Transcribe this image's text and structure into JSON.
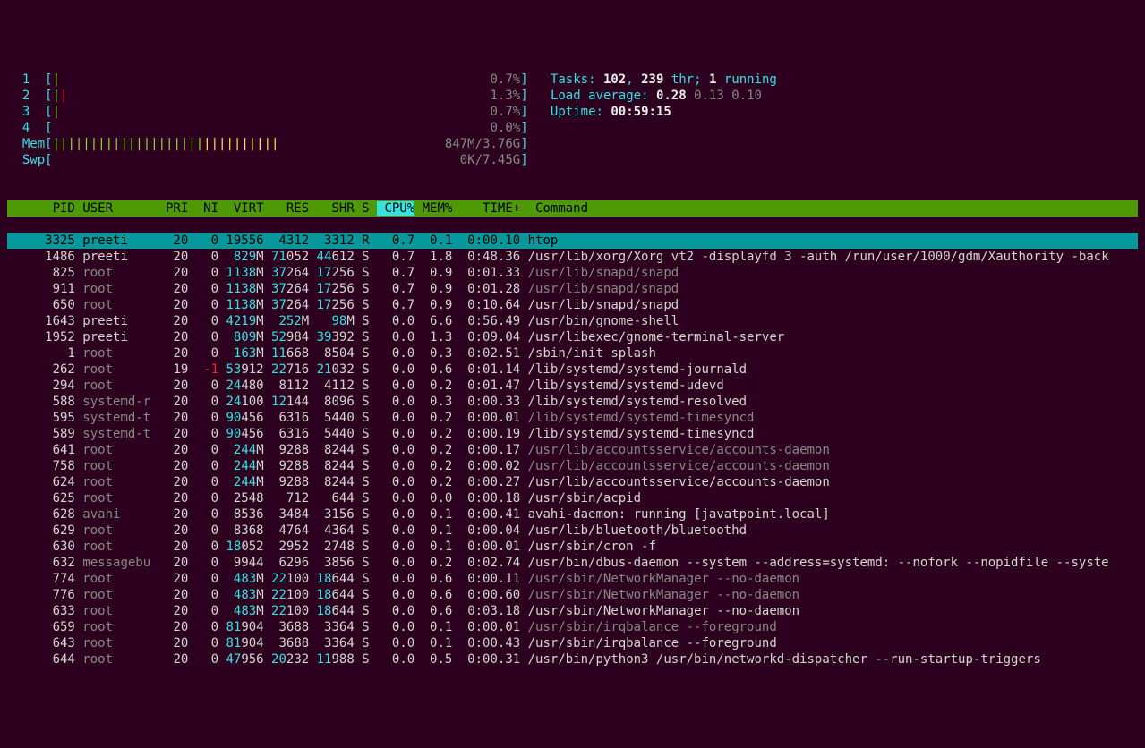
{
  "cpus": [
    {
      "id": "1",
      "pct": "0.7%"
    },
    {
      "id": "2",
      "pct": "1.3%"
    },
    {
      "id": "3",
      "pct": "0.7%"
    },
    {
      "id": "4",
      "pct": "0.0%"
    }
  ],
  "mem": {
    "label": "Mem",
    "used": "847M",
    "total": "3.76G"
  },
  "swp": {
    "label": "Swp",
    "used": "0K",
    "total": "7.45G"
  },
  "tasks": {
    "label": "Tasks:",
    "total": "102",
    "threads": "239",
    "thr_label": "thr;",
    "running": "1",
    "running_label": "running"
  },
  "load": {
    "label": "Load average:",
    "a": "0.28",
    "b": "0.13",
    "c": "0.10"
  },
  "uptime": {
    "label": "Uptime:",
    "value": "00:59:15"
  },
  "columns": {
    "pid": "PID",
    "user": "USER",
    "pri": "PRI",
    "ni": "NI",
    "virt": "VIRT",
    "res": "RES",
    "shr": "SHR",
    "s": "S",
    "cpu": "CPU%",
    "mem": "MEM%",
    "time": "TIME+",
    "cmd": "Command"
  },
  "rows": [
    {
      "pid": "3325",
      "user": "preeti",
      "udim": false,
      "pri": "20",
      "ni": "0",
      "ni_red": false,
      "virt_hi": "",
      "virt_lo": "19556",
      "res_hi": "",
      "res_lo": "4312",
      "shr_hi": "",
      "shr_lo": "3312",
      "s": "R",
      "cpu": "0.7",
      "mem": "0.1",
      "time": "0:00.10",
      "cmd": "htop",
      "cmd_dim": false,
      "sel": true
    },
    {
      "pid": "1486",
      "user": "preeti",
      "udim": false,
      "pri": "20",
      "ni": "0",
      "ni_red": false,
      "virt_hi": "829",
      "virt_lo": "M",
      "res_hi": "71",
      "res_lo": "052",
      "shr_hi": "44",
      "shr_lo": "612",
      "s": "S",
      "cpu": "0.7",
      "mem": "1.8",
      "time": "0:48.36",
      "cmd": "/usr/lib/xorg/Xorg vt2 -displayfd 3 -auth /run/user/1000/gdm/Xauthority -back",
      "cmd_dim": false,
      "sel": false
    },
    {
      "pid": "825",
      "user": "root",
      "udim": true,
      "pri": "20",
      "ni": "0",
      "ni_red": false,
      "virt_hi": "1138",
      "virt_lo": "M",
      "res_hi": "37",
      "res_lo": "264",
      "shr_hi": "17",
      "shr_lo": "256",
      "s": "S",
      "cpu": "0.7",
      "mem": "0.9",
      "time": "0:01.33",
      "cmd": "/usr/lib/snapd/snapd",
      "cmd_dim": true,
      "sel": false
    },
    {
      "pid": "911",
      "user": "root",
      "udim": true,
      "pri": "20",
      "ni": "0",
      "ni_red": false,
      "virt_hi": "1138",
      "virt_lo": "M",
      "res_hi": "37",
      "res_lo": "264",
      "shr_hi": "17",
      "shr_lo": "256",
      "s": "S",
      "cpu": "0.7",
      "mem": "0.9",
      "time": "0:01.28",
      "cmd": "/usr/lib/snapd/snapd",
      "cmd_dim": true,
      "sel": false
    },
    {
      "pid": "650",
      "user": "root",
      "udim": true,
      "pri": "20",
      "ni": "0",
      "ni_red": false,
      "virt_hi": "1138",
      "virt_lo": "M",
      "res_hi": "37",
      "res_lo": "264",
      "shr_hi": "17",
      "shr_lo": "256",
      "s": "S",
      "cpu": "0.7",
      "mem": "0.9",
      "time": "0:10.64",
      "cmd": "/usr/lib/snapd/snapd",
      "cmd_dim": false,
      "sel": false
    },
    {
      "pid": "1643",
      "user": "preeti",
      "udim": false,
      "pri": "20",
      "ni": "0",
      "ni_red": false,
      "virt_hi": "4219",
      "virt_lo": "M",
      "res_hi": "252",
      "res_lo": "M",
      "shr_hi": "98",
      "shr_lo": "M",
      "s": "S",
      "cpu": "0.0",
      "mem": "6.6",
      "time": "0:56.49",
      "cmd": "/usr/bin/gnome-shell",
      "cmd_dim": false,
      "sel": false
    },
    {
      "pid": "1952",
      "user": "preeti",
      "udim": false,
      "pri": "20",
      "ni": "0",
      "ni_red": false,
      "virt_hi": "809",
      "virt_lo": "M",
      "res_hi": "52",
      "res_lo": "984",
      "shr_hi": "39",
      "shr_lo": "392",
      "s": "S",
      "cpu": "0.0",
      "mem": "1.3",
      "time": "0:09.04",
      "cmd": "/usr/libexec/gnome-terminal-server",
      "cmd_dim": false,
      "sel": false
    },
    {
      "pid": "1",
      "user": "root",
      "udim": true,
      "pri": "20",
      "ni": "0",
      "ni_red": false,
      "virt_hi": "163",
      "virt_lo": "M",
      "res_hi": "11",
      "res_lo": "668",
      "shr_hi": "",
      "shr_lo": "8504",
      "s": "S",
      "cpu": "0.0",
      "mem": "0.3",
      "time": "0:02.51",
      "cmd": "/sbin/init splash",
      "cmd_dim": false,
      "sel": false
    },
    {
      "pid": "262",
      "user": "root",
      "udim": true,
      "pri": "19",
      "ni": "-1",
      "ni_red": true,
      "virt_hi": "53",
      "virt_lo": "912",
      "res_hi": "22",
      "res_lo": "716",
      "shr_hi": "21",
      "shr_lo": "032",
      "s": "S",
      "cpu": "0.0",
      "mem": "0.6",
      "time": "0:01.14",
      "cmd": "/lib/systemd/systemd-journald",
      "cmd_dim": false,
      "sel": false
    },
    {
      "pid": "294",
      "user": "root",
      "udim": true,
      "pri": "20",
      "ni": "0",
      "ni_red": false,
      "virt_hi": "24",
      "virt_lo": "480",
      "res_hi": "",
      "res_lo": "8112",
      "shr_hi": "",
      "shr_lo": "4112",
      "s": "S",
      "cpu": "0.0",
      "mem": "0.2",
      "time": "0:01.47",
      "cmd": "/lib/systemd/systemd-udevd",
      "cmd_dim": false,
      "sel": false
    },
    {
      "pid": "588",
      "user": "systemd-r",
      "udim": true,
      "pri": "20",
      "ni": "0",
      "ni_red": false,
      "virt_hi": "24",
      "virt_lo": "100",
      "res_hi": "12",
      "res_lo": "144",
      "shr_hi": "",
      "shr_lo": "8096",
      "s": "S",
      "cpu": "0.0",
      "mem": "0.3",
      "time": "0:00.33",
      "cmd": "/lib/systemd/systemd-resolved",
      "cmd_dim": false,
      "sel": false
    },
    {
      "pid": "595",
      "user": "systemd-t",
      "udim": true,
      "pri": "20",
      "ni": "0",
      "ni_red": false,
      "virt_hi": "90",
      "virt_lo": "456",
      "res_hi": "",
      "res_lo": "6316",
      "shr_hi": "",
      "shr_lo": "5440",
      "s": "S",
      "cpu": "0.0",
      "mem": "0.2",
      "time": "0:00.01",
      "cmd": "/lib/systemd/systemd-timesyncd",
      "cmd_dim": true,
      "sel": false
    },
    {
      "pid": "589",
      "user": "systemd-t",
      "udim": true,
      "pri": "20",
      "ni": "0",
      "ni_red": false,
      "virt_hi": "90",
      "virt_lo": "456",
      "res_hi": "",
      "res_lo": "6316",
      "shr_hi": "",
      "shr_lo": "5440",
      "s": "S",
      "cpu": "0.0",
      "mem": "0.2",
      "time": "0:00.19",
      "cmd": "/lib/systemd/systemd-timesyncd",
      "cmd_dim": false,
      "sel": false
    },
    {
      "pid": "641",
      "user": "root",
      "udim": true,
      "pri": "20",
      "ni": "0",
      "ni_red": false,
      "virt_hi": "244",
      "virt_lo": "M",
      "res_hi": "",
      "res_lo": "9288",
      "shr_hi": "",
      "shr_lo": "8244",
      "s": "S",
      "cpu": "0.0",
      "mem": "0.2",
      "time": "0:00.17",
      "cmd": "/usr/lib/accountsservice/accounts-daemon",
      "cmd_dim": true,
      "sel": false
    },
    {
      "pid": "758",
      "user": "root",
      "udim": true,
      "pri": "20",
      "ni": "0",
      "ni_red": false,
      "virt_hi": "244",
      "virt_lo": "M",
      "res_hi": "",
      "res_lo": "9288",
      "shr_hi": "",
      "shr_lo": "8244",
      "s": "S",
      "cpu": "0.0",
      "mem": "0.2",
      "time": "0:00.02",
      "cmd": "/usr/lib/accountsservice/accounts-daemon",
      "cmd_dim": true,
      "sel": false
    },
    {
      "pid": "624",
      "user": "root",
      "udim": true,
      "pri": "20",
      "ni": "0",
      "ni_red": false,
      "virt_hi": "244",
      "virt_lo": "M",
      "res_hi": "",
      "res_lo": "9288",
      "shr_hi": "",
      "shr_lo": "8244",
      "s": "S",
      "cpu": "0.0",
      "mem": "0.2",
      "time": "0:00.27",
      "cmd": "/usr/lib/accountsservice/accounts-daemon",
      "cmd_dim": false,
      "sel": false
    },
    {
      "pid": "625",
      "user": "root",
      "udim": true,
      "pri": "20",
      "ni": "0",
      "ni_red": false,
      "virt_hi": "",
      "virt_lo": "2548",
      "res_hi": "",
      "res_lo": "712",
      "shr_hi": "",
      "shr_lo": "644",
      "s": "S",
      "cpu": "0.0",
      "mem": "0.0",
      "time": "0:00.18",
      "cmd": "/usr/sbin/acpid",
      "cmd_dim": false,
      "sel": false
    },
    {
      "pid": "628",
      "user": "avahi",
      "udim": true,
      "pri": "20",
      "ni": "0",
      "ni_red": false,
      "virt_hi": "",
      "virt_lo": "8536",
      "res_hi": "",
      "res_lo": "3484",
      "shr_hi": "",
      "shr_lo": "3156",
      "s": "S",
      "cpu": "0.0",
      "mem": "0.1",
      "time": "0:00.41",
      "cmd": "avahi-daemon: running [javatpoint.local]",
      "cmd_dim": false,
      "sel": false
    },
    {
      "pid": "629",
      "user": "root",
      "udim": true,
      "pri": "20",
      "ni": "0",
      "ni_red": false,
      "virt_hi": "",
      "virt_lo": "8368",
      "res_hi": "",
      "res_lo": "4764",
      "shr_hi": "",
      "shr_lo": "4364",
      "s": "S",
      "cpu": "0.0",
      "mem": "0.1",
      "time": "0:00.04",
      "cmd": "/usr/lib/bluetooth/bluetoothd",
      "cmd_dim": false,
      "sel": false
    },
    {
      "pid": "630",
      "user": "root",
      "udim": true,
      "pri": "20",
      "ni": "0",
      "ni_red": false,
      "virt_hi": "18",
      "virt_lo": "052",
      "res_hi": "",
      "res_lo": "2952",
      "shr_hi": "",
      "shr_lo": "2748",
      "s": "S",
      "cpu": "0.0",
      "mem": "0.1",
      "time": "0:00.01",
      "cmd": "/usr/sbin/cron -f",
      "cmd_dim": false,
      "sel": false
    },
    {
      "pid": "632",
      "user": "messagebu",
      "udim": true,
      "pri": "20",
      "ni": "0",
      "ni_red": false,
      "virt_hi": "",
      "virt_lo": "9944",
      "res_hi": "",
      "res_lo": "6296",
      "shr_hi": "",
      "shr_lo": "3856",
      "s": "S",
      "cpu": "0.0",
      "mem": "0.2",
      "time": "0:02.74",
      "cmd": "/usr/bin/dbus-daemon --system --address=systemd: --nofork --nopidfile --syste",
      "cmd_dim": false,
      "sel": false
    },
    {
      "pid": "774",
      "user": "root",
      "udim": true,
      "pri": "20",
      "ni": "0",
      "ni_red": false,
      "virt_hi": "483",
      "virt_lo": "M",
      "res_hi": "22",
      "res_lo": "100",
      "shr_hi": "18",
      "shr_lo": "644",
      "s": "S",
      "cpu": "0.0",
      "mem": "0.6",
      "time": "0:00.11",
      "cmd": "/usr/sbin/NetworkManager --no-daemon",
      "cmd_dim": true,
      "sel": false
    },
    {
      "pid": "776",
      "user": "root",
      "udim": true,
      "pri": "20",
      "ni": "0",
      "ni_red": false,
      "virt_hi": "483",
      "virt_lo": "M",
      "res_hi": "22",
      "res_lo": "100",
      "shr_hi": "18",
      "shr_lo": "644",
      "s": "S",
      "cpu": "0.0",
      "mem": "0.6",
      "time": "0:00.60",
      "cmd": "/usr/sbin/NetworkManager --no-daemon",
      "cmd_dim": true,
      "sel": false
    },
    {
      "pid": "633",
      "user": "root",
      "udim": true,
      "pri": "20",
      "ni": "0",
      "ni_red": false,
      "virt_hi": "483",
      "virt_lo": "M",
      "res_hi": "22",
      "res_lo": "100",
      "shr_hi": "18",
      "shr_lo": "644",
      "s": "S",
      "cpu": "0.0",
      "mem": "0.6",
      "time": "0:03.18",
      "cmd": "/usr/sbin/NetworkManager --no-daemon",
      "cmd_dim": false,
      "sel": false
    },
    {
      "pid": "659",
      "user": "root",
      "udim": true,
      "pri": "20",
      "ni": "0",
      "ni_red": false,
      "virt_hi": "81",
      "virt_lo": "904",
      "res_hi": "",
      "res_lo": "3688",
      "shr_hi": "",
      "shr_lo": "3364",
      "s": "S",
      "cpu": "0.0",
      "mem": "0.1",
      "time": "0:00.01",
      "cmd": "/usr/sbin/irqbalance --foreground",
      "cmd_dim": true,
      "sel": false
    },
    {
      "pid": "643",
      "user": "root",
      "udim": true,
      "pri": "20",
      "ni": "0",
      "ni_red": false,
      "virt_hi": "81",
      "virt_lo": "904",
      "res_hi": "",
      "res_lo": "3688",
      "shr_hi": "",
      "shr_lo": "3364",
      "s": "S",
      "cpu": "0.0",
      "mem": "0.1",
      "time": "0:00.43",
      "cmd": "/usr/sbin/irqbalance --foreground",
      "cmd_dim": false,
      "sel": false
    },
    {
      "pid": "644",
      "user": "root",
      "udim": true,
      "pri": "20",
      "ni": "0",
      "ni_red": false,
      "virt_hi": "47",
      "virt_lo": "956",
      "res_hi": "20",
      "res_lo": "232",
      "shr_hi": "11",
      "shr_lo": "988",
      "s": "S",
      "cpu": "0.0",
      "mem": "0.5",
      "time": "0:00.31",
      "cmd": "/usr/bin/python3 /usr/bin/networkd-dispatcher --run-startup-triggers",
      "cmd_dim": false,
      "sel": false
    }
  ]
}
